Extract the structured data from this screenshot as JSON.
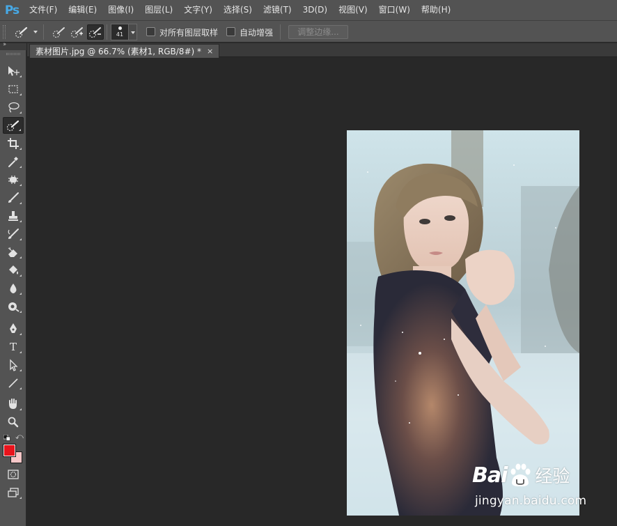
{
  "app": {
    "logo": "Ps",
    "accent_color": "#47a9e6"
  },
  "menu": [
    "文件(F)",
    "编辑(E)",
    "图像(I)",
    "图层(L)",
    "文字(Y)",
    "选择(S)",
    "滤镜(T)",
    "3D(D)",
    "视图(V)",
    "窗口(W)",
    "帮助(H)"
  ],
  "options": {
    "brush_size": "41",
    "sample_all_layers_label": "对所有图层取样",
    "sample_all_layers_checked": false,
    "auto_enhance_label": "自动增强",
    "auto_enhance_checked": false,
    "refine_edge_label": "调整边缘...",
    "tool_icons": [
      "quick-selection-tool-icon",
      "new-selection-icon",
      "add-to-selection-icon",
      "subtract-from-selection-icon"
    ]
  },
  "tools": [
    "move-tool-icon",
    "marquee-tool-icon",
    "lasso-tool-icon",
    "quick-selection-tool-icon",
    "crop-tool-icon",
    "eyedropper-tool-icon",
    "healing-brush-tool-icon",
    "brush-tool-icon",
    "clone-stamp-tool-icon",
    "history-brush-tool-icon",
    "eraser-tool-icon",
    "paint-bucket-tool-icon",
    "blur-tool-icon",
    "dodge-tool-icon",
    "pen-tool-icon",
    "type-tool-icon",
    "path-selection-tool-icon",
    "line-tool-icon",
    "hand-tool-icon",
    "zoom-tool-icon",
    "quick-mask-icon",
    "screen-mode-icon"
  ],
  "active_tool": "quick-selection-tool-icon",
  "type_tool_glyph": "T",
  "colors": {
    "foreground": "#e8141c",
    "background": "#f6c7c8"
  },
  "document": {
    "tab_title": "素材图片.jpg @ 66.7% (素材1, RGB/8#) *",
    "close_glyph": "×"
  },
  "watermark": {
    "brand_left": "Bai",
    "brand_right": "经验",
    "url": "jingyan.baidu.com"
  }
}
